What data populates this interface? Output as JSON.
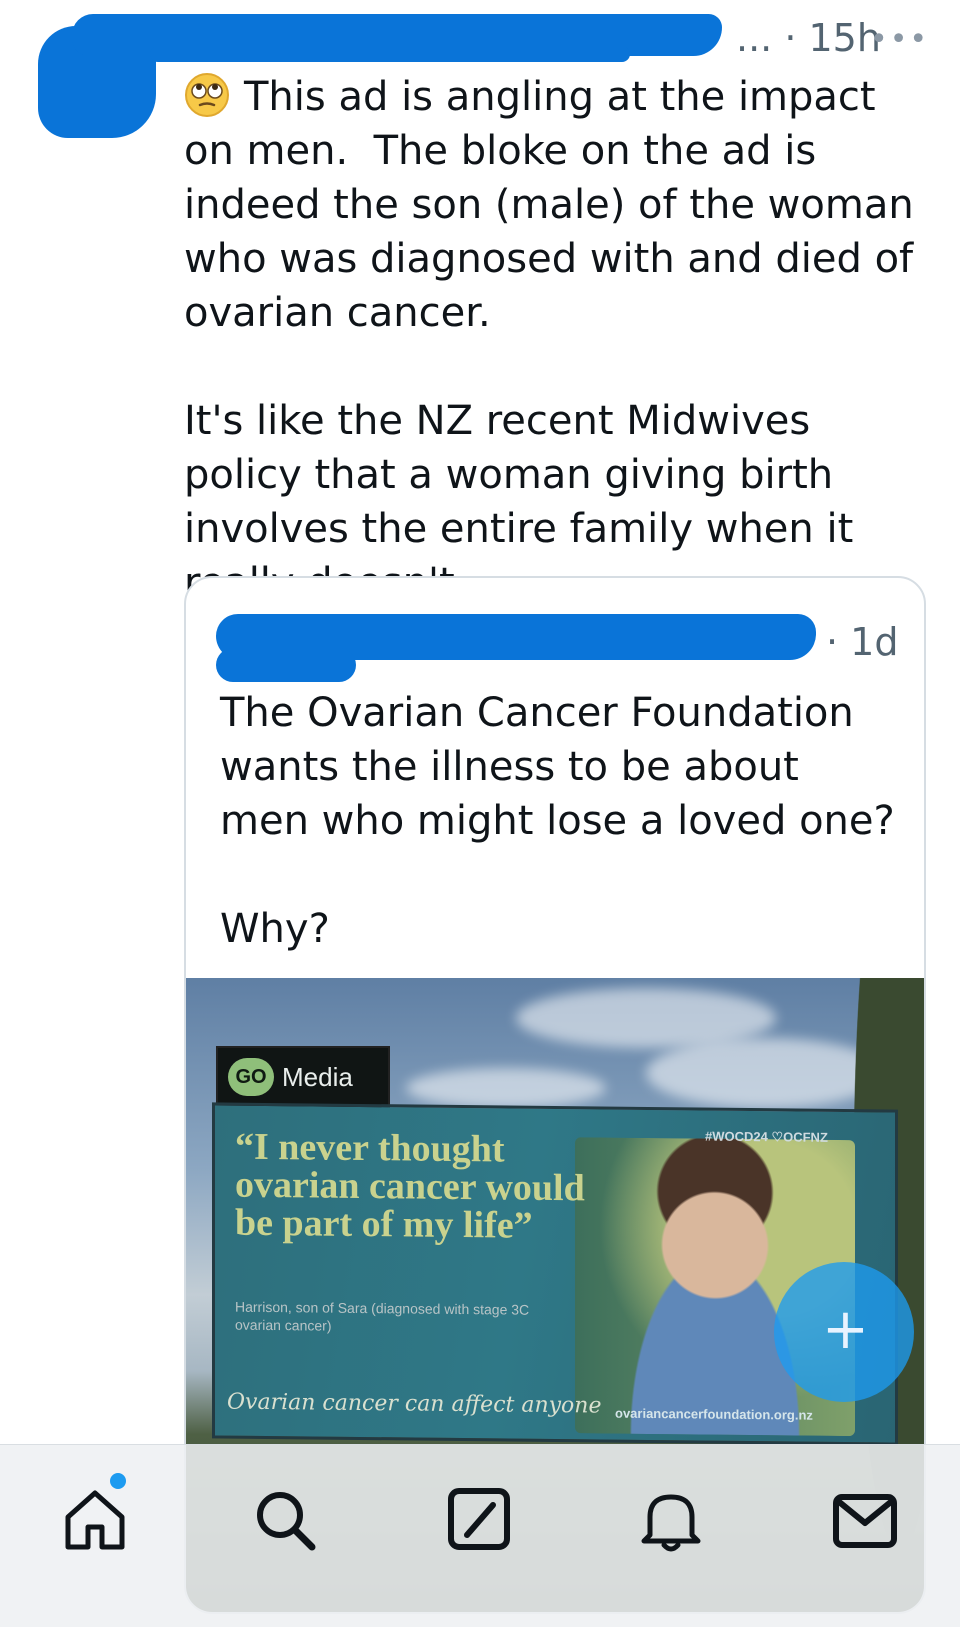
{
  "post": {
    "time": "... · 15h",
    "more_label": "•••",
    "emoji": "face-with-rolling-eyes",
    "text": "This ad is angling at the impact on men.  The bloke on the ad is indeed the son (male) of the woman who was diagnosed with and died of ovarian cancer.\n\nIt's like the NZ recent Midwives policy that a woman giving birth involves the entire family when it really doesn't."
  },
  "quote": {
    "time": "· 1d",
    "text": "The Ovarian Cancer Foundation wants the illness to be about men who might lose a loved one?\n\nWhy?",
    "image": {
      "brand_go": "GO",
      "brand_media": "Media",
      "headline": "“I never thought ovarian cancer would be part of my life”",
      "subline": "Harrison, son of Sara (diagnosed with stage 3C ovarian cancer)",
      "hashtags": "#WOCD24  ♡OCFNZ",
      "slogan": "Ovarian cancer can affect anyone",
      "url": "ovariancancerfoundation.org.nz"
    }
  },
  "fab": {
    "label": "+"
  },
  "nav": {
    "items": [
      "home-icon",
      "search-icon",
      "grok-icon",
      "notifications-icon",
      "messages-icon"
    ],
    "home_has_badge": true
  },
  "colors": {
    "accent": "#1d9bf0",
    "redaction": "#0a74d8",
    "text": "#0f1419",
    "muted": "#536471"
  }
}
